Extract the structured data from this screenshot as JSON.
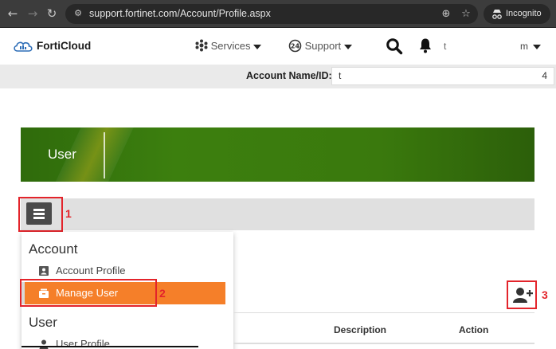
{
  "browser": {
    "url": "support.fortinet.com/Account/Profile.aspx",
    "incognito_label": "Incognito"
  },
  "header": {
    "brand": "FortiCloud",
    "services_label": "Services",
    "support_label": "Support",
    "user_short": "t",
    "user_menu": "m"
  },
  "account_bar": {
    "label": "Account Name/ID:",
    "value": "t",
    "value_right": "4"
  },
  "banner": {
    "title": "User"
  },
  "callouts": [
    "1",
    "2",
    "3"
  ],
  "menu": {
    "account_heading": "Account",
    "account_profile": "Account Profile",
    "manage_user": "Manage User",
    "user_heading": "User",
    "user_profile": "User Profile"
  },
  "table": {
    "columns": [
      "Description",
      "Action"
    ]
  },
  "colors": {
    "accent_orange": "#f57f29",
    "banner_green": "#3c7f0e",
    "callout_red": "#e3242b"
  },
  "icons": [
    "back-icon",
    "forward-icon",
    "reload-icon",
    "site-info-icon",
    "zoom-icon",
    "bookmark-star-icon",
    "incognito-icon",
    "forticloud-logo-icon",
    "services-icon",
    "support-icon",
    "search-icon",
    "bell-icon",
    "hamburger-icon",
    "account-profile-icon",
    "manage-user-icon",
    "user-profile-icon",
    "add-user-icon"
  ]
}
